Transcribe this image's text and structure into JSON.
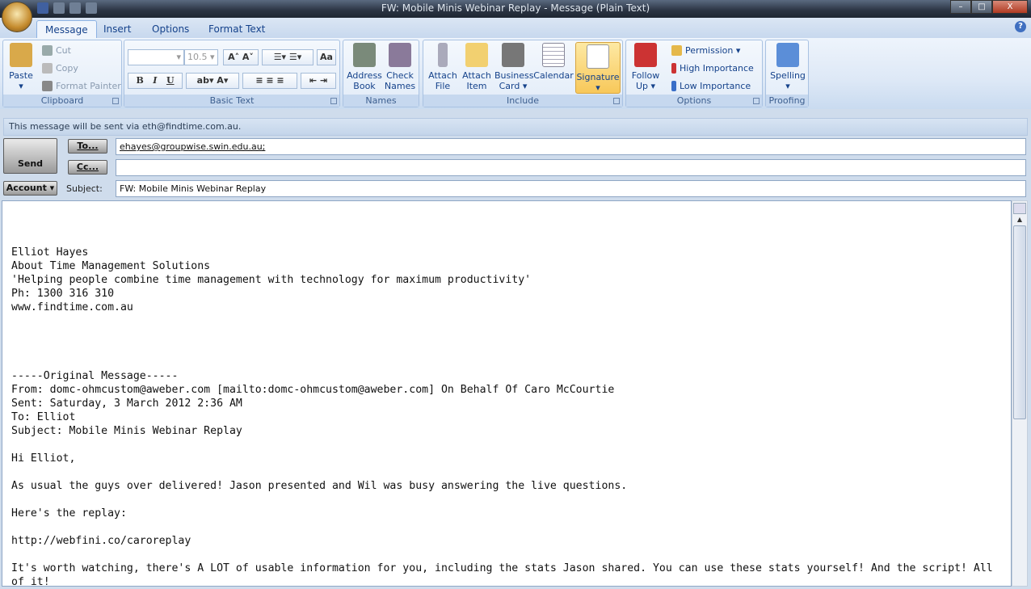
{
  "window": {
    "title": "FW: Mobile Minis Webinar Replay - Message (Plain Text)",
    "minimize": "–",
    "maximize": "□",
    "close": "X"
  },
  "tabs": [
    "Message",
    "Insert",
    "Options",
    "Format Text"
  ],
  "help": "?",
  "ribbon": {
    "clipboard": {
      "label": "Clipboard",
      "paste": "Paste",
      "cut": "Cut",
      "copy": "Copy",
      "format_painter": "Format Painter"
    },
    "basic_text": {
      "label": "Basic Text",
      "font": "",
      "size": "10.5",
      "bold": "B",
      "italic": "I",
      "underline": "U"
    },
    "names": {
      "label": "Names",
      "address_book": [
        "Address",
        "Book"
      ],
      "check_names": [
        "Check",
        "Names"
      ]
    },
    "include": {
      "label": "Include",
      "attach_file": [
        "Attach",
        "File"
      ],
      "attach_item": [
        "Attach",
        "Item"
      ],
      "business_card": [
        "Business",
        "Card ▾"
      ],
      "calendar": "Calendar",
      "signature": "Signature"
    },
    "options": {
      "label": "Options",
      "follow_up": [
        "Follow",
        "Up ▾"
      ],
      "permission": "Permission ▾",
      "high": "High Importance",
      "low": "Low Importance"
    },
    "proofing": {
      "label": "Proofing",
      "spelling": "Spelling"
    }
  },
  "info_bar": "This message will be sent via eth@findtime.com.au.",
  "compose": {
    "send": "Send",
    "to_btn": "To...",
    "cc_btn": "Cc...",
    "account_btn": "Account ▾",
    "subject_label": "Subject:",
    "to_value": "ehayes@groupwise.swin.edu.au;",
    "cc_value": "",
    "subject_value": "FW: Mobile Minis Webinar Replay"
  },
  "body": "\n\n\nElliot Hayes\nAbout Time Management Solutions\n'Helping people combine time management with technology for maximum productivity'\nPh: 1300 316 310\nwww.findtime.com.au\n\n\n\n\n-----Original Message-----\nFrom: domc-ohmcustom@aweber.com [mailto:domc-ohmcustom@aweber.com] On Behalf Of Caro McCourtie\nSent: Saturday, 3 March 2012 2:36 AM\nTo: Elliot\nSubject: Mobile Minis Webinar Replay\n\nHi Elliot,\n\nAs usual the guys over delivered! Jason presented and Wil was busy answering the live questions.\n\nHere's the replay:\n\nhttp://webfini.co/caroreplay\n\nIt's worth watching, there's A LOT of usable information for you, including the stats Jason shared. You can use these stats yourself! And the script! All\nof it!"
}
